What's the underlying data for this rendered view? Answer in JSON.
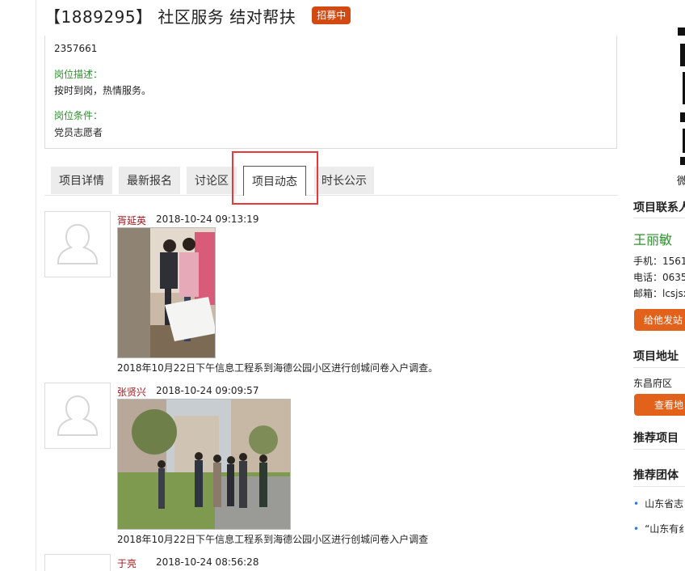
{
  "project": {
    "title": "【1889295】 社区服务 结对帮扶",
    "status_badge": "招募中"
  },
  "info": {
    "phone_value": "2357661",
    "desc_label": "岗位描述：",
    "desc_value": "按时到岗，热情服务。",
    "cond_label": "岗位条件：",
    "cond_value": "党员志愿者"
  },
  "tabs": [
    {
      "label": "项目详情"
    },
    {
      "label": "最新报名"
    },
    {
      "label": "讨论区"
    },
    {
      "label": "项目动态"
    },
    {
      "label": "时长公示"
    }
  ],
  "feed": [
    {
      "author": "胥延英",
      "time": "2018-10-24 09:13:19",
      "caption": "2018年10月22日下午信息工程系到海德公园小区进行创城问卷入户调查。"
    },
    {
      "author": "张贤兴",
      "time": "2018-10-24 09:09:57",
      "caption": "2018年10月22日下午信息工程系到海德公园小区进行创城问卷入户调查"
    },
    {
      "author": "于亮",
      "time": "2018-10-24 08:56:28"
    }
  ],
  "sidebar": {
    "qr_label": "微",
    "contact_heading": "项目联系人",
    "contact_name": "王丽敏",
    "mobile": "手机：1561",
    "tel": "电话：0635",
    "email": "邮箱：lcsjsx",
    "message_button": "给他发站",
    "address_heading": "项目地址",
    "address_value": "东昌府区",
    "map_button": "查看地",
    "recommend_projects": "推荐项目",
    "recommend_groups": "推荐团体",
    "group_items": [
      "山东省志",
      "“山东有纟"
    ]
  },
  "colors": {
    "badge": "#d24a12",
    "author": "#a0191f",
    "label_green": "#2f8f2f",
    "highlight": "#e63a3a",
    "side_button": "#e2621c"
  }
}
